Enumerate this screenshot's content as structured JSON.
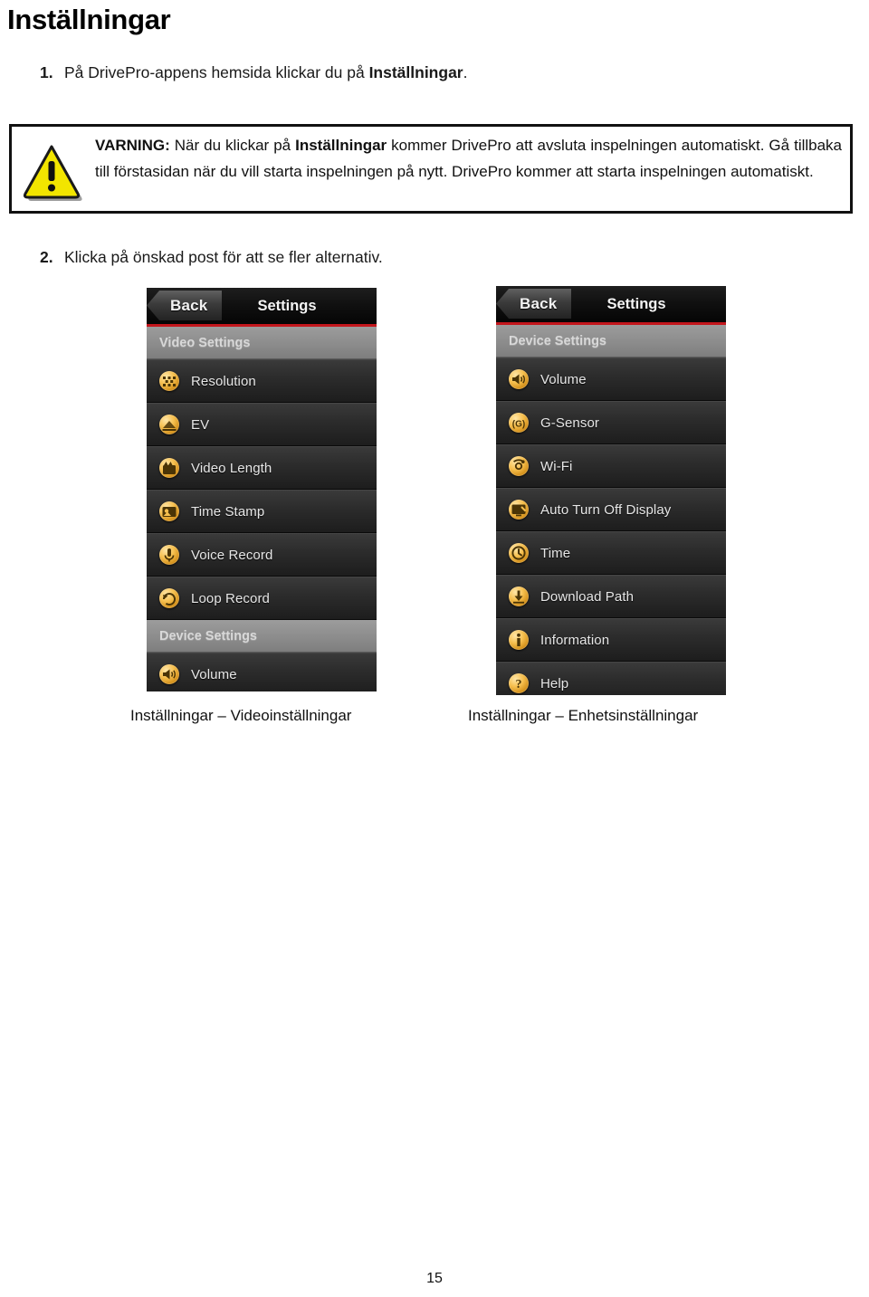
{
  "document": {
    "heading": "Inställningar",
    "page_number": "15"
  },
  "steps": [
    {
      "number": "1.",
      "text_before": "På DrivePro-appens hemsida klickar du på ",
      "text_bold": "Inställningar",
      "text_after": "."
    },
    {
      "number": "2.",
      "text_before": "Klicka på önskad post för att se fler alternativ.",
      "text_bold": "",
      "text_after": ""
    }
  ],
  "warning": {
    "icon": "warning-triangle-icon",
    "label": "VARNING:",
    "body_1": " När du klickar på ",
    "bold_1": "Inställningar",
    "body_2": " kommer DrivePro att avsluta inspelningen automatiskt. Gå tillbaka till förstasidan när du vill starta inspelningen på nytt. DrivePro kommer att starta inspelningen automatiskt.",
    "border_color": "#111111",
    "icon_color": "#f2e500"
  },
  "screenshots": [
    {
      "id": "video-settings",
      "back_label": "Back",
      "title": "Settings",
      "accent_color": "#c3161c",
      "caption": "Inställningar – Videoinställningar",
      "items": [
        {
          "type": "section",
          "label": "Video Settings"
        },
        {
          "type": "row",
          "label": "Resolution",
          "icon": "resolution-icon"
        },
        {
          "type": "row",
          "label": "EV",
          "icon": "ev-icon"
        },
        {
          "type": "row",
          "label": "Video Length",
          "icon": "video-length-icon"
        },
        {
          "type": "row",
          "label": "Time Stamp",
          "icon": "time-stamp-icon"
        },
        {
          "type": "row",
          "label": "Voice Record",
          "icon": "voice-record-icon"
        },
        {
          "type": "row",
          "label": "Loop Record",
          "icon": "loop-record-icon"
        },
        {
          "type": "section",
          "label": "Device Settings"
        },
        {
          "type": "row",
          "label": "Volume",
          "icon": "volume-icon"
        }
      ]
    },
    {
      "id": "device-settings",
      "back_label": "Back",
      "title": "Settings",
      "accent_color": "#c3161c",
      "caption": "Inställningar – Enhetsinställningar",
      "items": [
        {
          "type": "section",
          "label": "Device Settings"
        },
        {
          "type": "row",
          "label": "Volume",
          "icon": "volume-icon"
        },
        {
          "type": "row",
          "label": "G-Sensor",
          "icon": "g-sensor-icon"
        },
        {
          "type": "row",
          "label": "Wi-Fi",
          "icon": "wifi-icon"
        },
        {
          "type": "row",
          "label": "Auto Turn Off Display",
          "icon": "auto-turn-off-display-icon"
        },
        {
          "type": "row",
          "label": "Time",
          "icon": "clock-icon"
        },
        {
          "type": "row",
          "label": "Download Path",
          "icon": "download-icon"
        },
        {
          "type": "row",
          "label": "Information",
          "icon": "info-icon"
        },
        {
          "type": "row",
          "label": "Help",
          "icon": "help-icon"
        }
      ]
    }
  ]
}
